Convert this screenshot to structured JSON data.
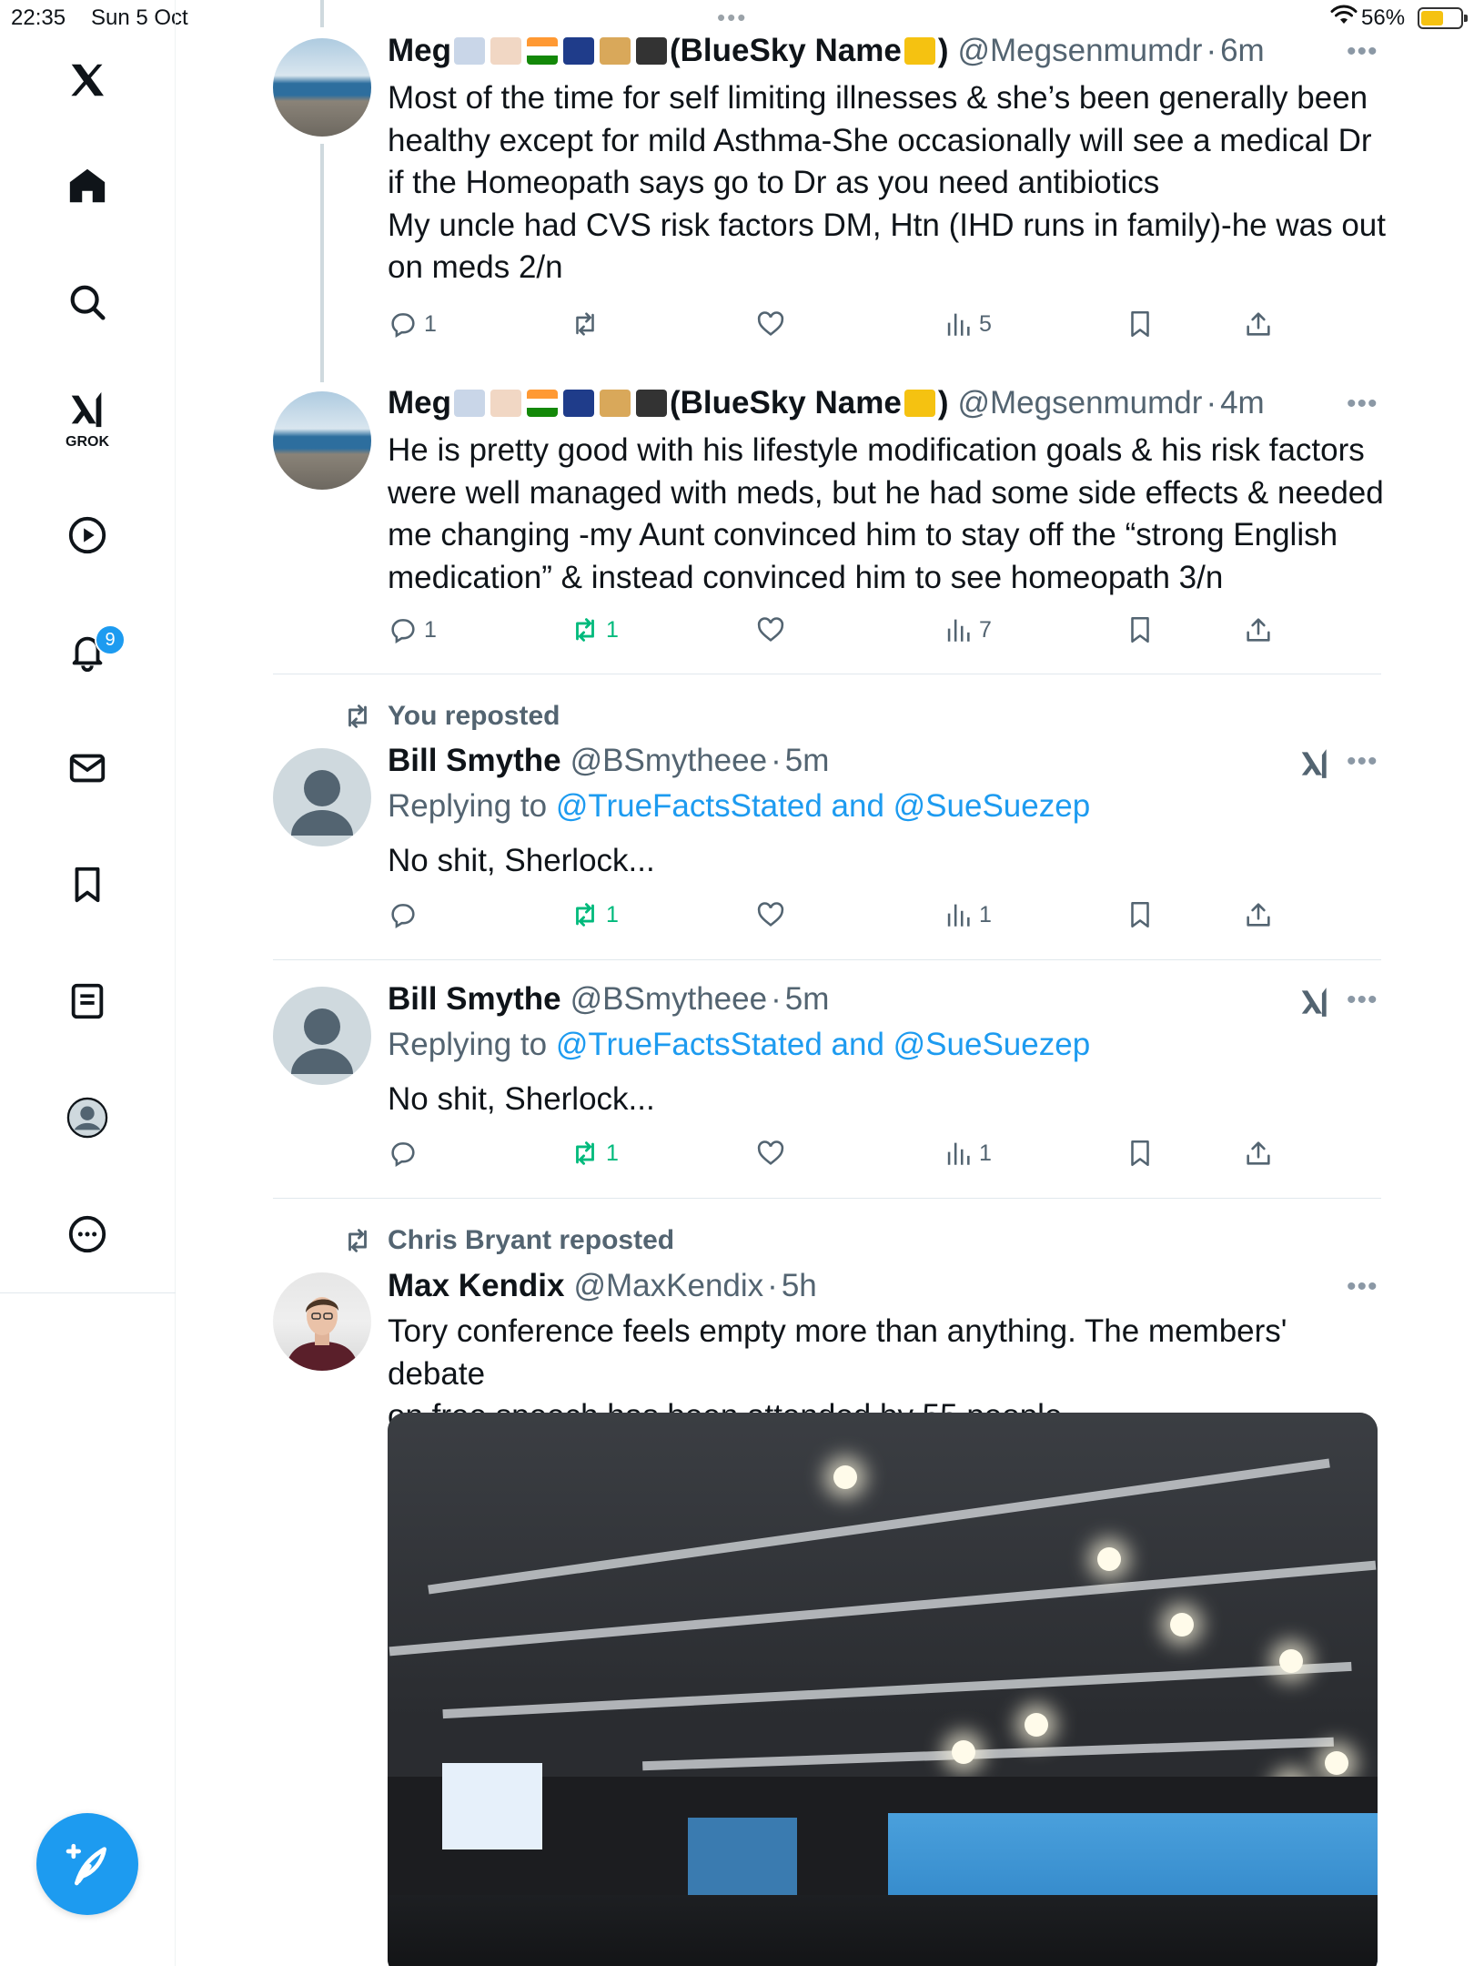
{
  "status_bar": {
    "time": "22:35",
    "date": "Sun 5 Oct",
    "battery": "56%",
    "battery_level": 0.56,
    "center_dots": "•••"
  },
  "sidebar": {
    "grok_label": "GROK",
    "notifications_badge": "9"
  },
  "colors": {
    "accent": "#1d9bf0",
    "repost_green": "#00ba7c",
    "secondary_text": "#536471",
    "divider": "#e1e8ed"
  },
  "tweets": [
    {
      "name": "Meg",
      "name_suffix": "(BlueSky Name",
      "name_close": ")",
      "handle": "@Megsenmumdr",
      "separator": "·",
      "time": "6m",
      "text_lines": [
        "Most of the time for self limiting illnesses & she’s been generally been",
        "healthy except for mild Asthma-She occasionally will see a medical Dr",
        "if the Homeopath says go to Dr as you need antibiotics",
        "My uncle had CVS risk factors DM, Htn (IHD runs in family)-he was out",
        "on meds 2/n"
      ],
      "replies": "1",
      "reposts": "",
      "views": "5"
    },
    {
      "name": "Meg",
      "name_suffix": "(BlueSky Name",
      "name_close": ")",
      "handle": "@Megsenmumdr",
      "separator": "·",
      "time": "4m",
      "text_lines": [
        "He is pretty good with his lifestyle modification goals & his risk factors",
        "were well managed with meds, but he had some side effects & needed",
        "me changing -my Aunt convinced him to stay off the “strong English",
        "medication” & instead convinced him to see homeopath 3/n"
      ],
      "replies": "1",
      "reposts": "1",
      "views": "7"
    },
    {
      "repost_label": "You reposted",
      "name": "Bill Smythe",
      "handle": "@BSmytheee",
      "separator": "·",
      "time": "5m",
      "replying_prefix": "Replying to",
      "replying_to": "@TrueFactsStated and @SueSuezep",
      "text": "No shit, Sherlock...",
      "replies": "",
      "reposts": "1",
      "views": "1"
    },
    {
      "name": "Bill Smythe",
      "handle": "@BSmytheee",
      "separator": "·",
      "time": "5m",
      "replying_prefix": "Replying to",
      "replying_to": "@TrueFactsStated and @SueSuezep",
      "text": "No shit, Sherlock...",
      "replies": "",
      "reposts": "1",
      "views": "1"
    },
    {
      "repost_label": "Chris Bryant reposted",
      "name": "Max Kendix",
      "handle": "@MaxKendix",
      "separator": "·",
      "time": "5h",
      "text_lines": [
        "Tory conference feels empty more than anything. The members' debate",
        "on free speech has been attended by 55 people"
      ]
    }
  ]
}
